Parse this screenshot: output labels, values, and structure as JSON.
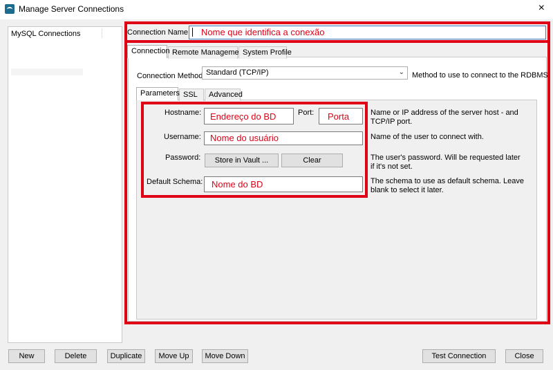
{
  "window": {
    "title": "Manage Server Connections",
    "close_glyph": "×"
  },
  "sidebar": {
    "header": "MySQL Connections"
  },
  "connection_name": {
    "label": "Connection Name:",
    "value": "Nome que identifica a conexão"
  },
  "main_tabs": [
    "Connection",
    "Remote Management",
    "System Profile"
  ],
  "connection_method": {
    "label": "Connection Method:",
    "value": "Standard (TCP/IP)",
    "help": "Method to use to connect to the RDBMS"
  },
  "sub_tabs": [
    "Parameters",
    "SSL",
    "Advanced"
  ],
  "params": {
    "hostname": {
      "label": "Hostname:",
      "value": "Endereço do BD"
    },
    "port": {
      "label": "Port:",
      "value": "Porta"
    },
    "host_help": "Name or IP address of the server host - and TCP/IP port.",
    "username": {
      "label": "Username:",
      "value": "Nome do usuário",
      "help": "Name of the user to connect with."
    },
    "password": {
      "label": "Password:",
      "store_btn": "Store in Vault ...",
      "clear_btn": "Clear",
      "help": "The user's password. Will be requested later if it's not set."
    },
    "schema": {
      "label": "Default Schema:",
      "value": "Nome do BD",
      "help": "The schema to use as default schema. Leave blank to select it later."
    }
  },
  "footer": {
    "new": "New",
    "delete": "Delete",
    "duplicate": "Duplicate",
    "move_up": "Move Up",
    "move_down": "Move Down",
    "test": "Test Connection",
    "close": "Close"
  },
  "colors": {
    "annotation": "#e00016"
  }
}
